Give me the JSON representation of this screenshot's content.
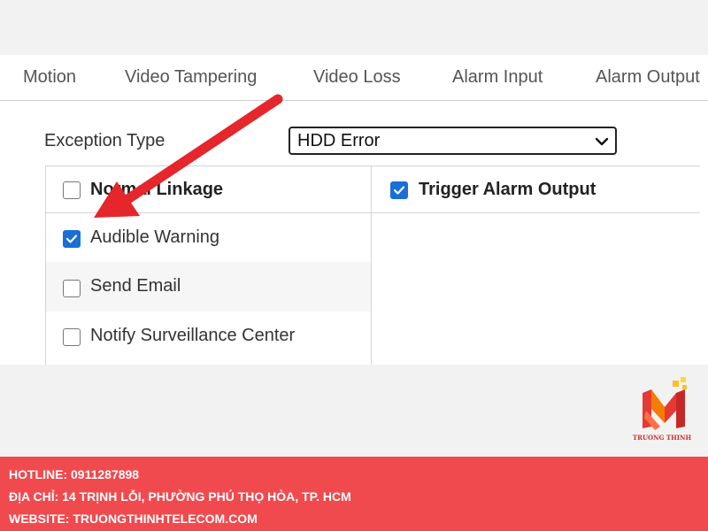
{
  "tabs": [
    "Motion",
    "Video Tampering",
    "Video Loss",
    "Alarm Input",
    "Alarm Output"
  ],
  "exception": {
    "label": "Exception Type",
    "selected": "HDD Error"
  },
  "linkage": {
    "normal_header": "Normal Linkage",
    "normal_header_checked": false,
    "trigger_header": "Trigger Alarm Output",
    "trigger_header_checked": true,
    "items": [
      {
        "label": "Audible Warning",
        "checked": true
      },
      {
        "label": "Send Email",
        "checked": false
      },
      {
        "label": "Notify Surveillance Center",
        "checked": false
      }
    ]
  },
  "colors": {
    "checkbox_checked": "#1a6fd6",
    "arrow": "#e5262b",
    "footer_bg": "#f04a4f"
  },
  "logo": {
    "brand": "TRUONG THINH"
  },
  "footer": {
    "hotline": "HOTLINE: 0911287898",
    "address": "ĐỊA CHỈ: 14 TRỊNH LỖI, PHƯỜNG PHÚ THỌ HÒA, TP. HCM",
    "website": "WEBSITE: TRUONGTHINHTELECOM.COM"
  }
}
